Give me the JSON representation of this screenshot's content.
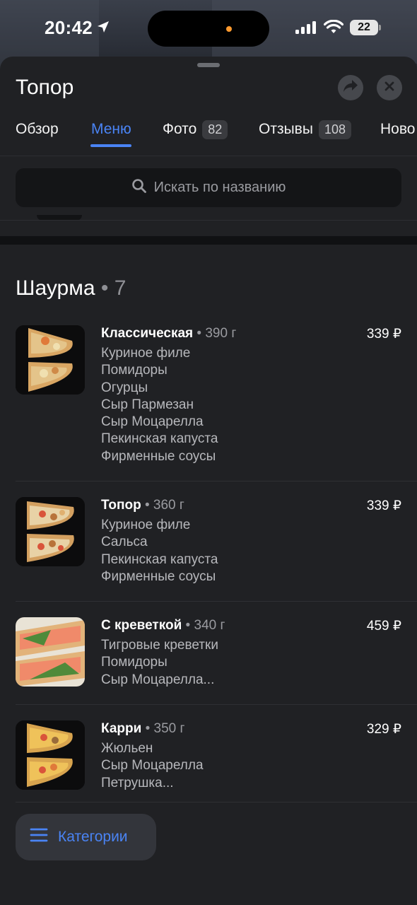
{
  "status_bar": {
    "time": "20:42",
    "battery": "22"
  },
  "header": {
    "title": "Топор"
  },
  "tabs": [
    {
      "label": "Обзор",
      "badge": ""
    },
    {
      "label": "Меню",
      "badge": ""
    },
    {
      "label": "Фото",
      "badge": "82"
    },
    {
      "label": "Отзывы",
      "badge": "108"
    },
    {
      "label": "Ново",
      "badge": ""
    }
  ],
  "active_tab": "Меню",
  "search": {
    "placeholder": "Искать по названию"
  },
  "section": {
    "title": "Шаурма",
    "count": "7"
  },
  "items": [
    {
      "name": "Классическая",
      "weight": "390 г",
      "price": "339 ₽",
      "description": [
        "Куриное филе",
        "Помидоры",
        "Огурцы",
        "Сыр Пармезан",
        "Сыр Моцарелла",
        "Пекинская капуста",
        "Фирменные соусы"
      ]
    },
    {
      "name": "Топор",
      "weight": "360 г",
      "price": "339 ₽",
      "description": [
        "Куриное филе",
        "Сальса",
        "Пекинская капуста",
        "Фирменные соусы"
      ]
    },
    {
      "name": "С креветкой",
      "weight": "340 г",
      "price": "459 ₽",
      "description": [
        "Тигровые креветки",
        "Помидоры",
        "Сыр Моцарелла..."
      ]
    },
    {
      "name": "Карри",
      "weight": "350 г",
      "price": "329 ₽",
      "description": [
        "Жюльен",
        "Сыр Моцарелла",
        "Петрушка..."
      ]
    }
  ],
  "categories_button": {
    "label": "Категории"
  },
  "colors": {
    "accent": "#4a84f5",
    "background": "#202124",
    "status_dot": "#ff9a2e"
  },
  "icons": {
    "location": "location-arrow-icon",
    "signal": "cellular-signal-icon",
    "wifi": "wifi-icon",
    "share": "share-icon",
    "close": "close-icon",
    "search": "search-icon",
    "menu": "hamburger-menu-icon"
  }
}
